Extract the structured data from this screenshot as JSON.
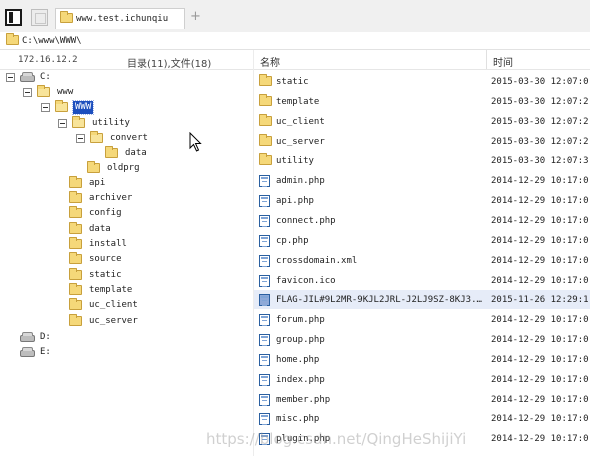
{
  "toolbar": {
    "sidebar_toggle_icon": "sidebar-icon",
    "new_window_icon": "window-icon"
  },
  "tab": {
    "title": "www.test.ichunqiu",
    "new_tab_label": "+"
  },
  "address": {
    "path": "C:\\www\\WWW\\"
  },
  "left": {
    "host": "172.16.12.2",
    "summary": "目录(11),文件(18)",
    "tree": [
      {
        "label": "C:",
        "kind": "drive",
        "expanded": true
      },
      {
        "label": "www",
        "kind": "folder",
        "expanded": true
      },
      {
        "label": "WWW",
        "kind": "folder",
        "expanded": true,
        "selected": true
      },
      {
        "label": "utility",
        "kind": "folder",
        "expanded": true
      },
      {
        "label": "convert",
        "kind": "folder",
        "expanded": true
      },
      {
        "label": "data",
        "kind": "folder"
      },
      {
        "label": "oldprg",
        "kind": "folder"
      },
      {
        "label": "api",
        "kind": "folder"
      },
      {
        "label": "archiver",
        "kind": "folder"
      },
      {
        "label": "config",
        "kind": "folder"
      },
      {
        "label": "data",
        "kind": "folder"
      },
      {
        "label": "install",
        "kind": "folder"
      },
      {
        "label": "source",
        "kind": "folder"
      },
      {
        "label": "static",
        "kind": "folder"
      },
      {
        "label": "template",
        "kind": "folder"
      },
      {
        "label": "uc_client",
        "kind": "folder"
      },
      {
        "label": "uc_server",
        "kind": "folder"
      },
      {
        "label": "D:",
        "kind": "drive"
      },
      {
        "label": "E:",
        "kind": "drive"
      }
    ]
  },
  "right": {
    "columns": {
      "name": "名称",
      "time": "时间"
    },
    "files": [
      {
        "name": "static",
        "time": "2015-03-30 12:07:0",
        "type": "folder"
      },
      {
        "name": "template",
        "time": "2015-03-30 12:07:2",
        "type": "folder"
      },
      {
        "name": "uc_client",
        "time": "2015-03-30 12:07:2",
        "type": "folder"
      },
      {
        "name": "uc_server",
        "time": "2015-03-30 12:07:2",
        "type": "folder"
      },
      {
        "name": "utility",
        "time": "2015-03-30 12:07:3",
        "type": "folder"
      },
      {
        "name": "admin.php",
        "time": "2014-12-29 10:17:0",
        "type": "file"
      },
      {
        "name": "api.php",
        "time": "2014-12-29 10:17:0",
        "type": "file"
      },
      {
        "name": "connect.php",
        "time": "2014-12-29 10:17:0",
        "type": "file"
      },
      {
        "name": "cp.php",
        "time": "2014-12-29 10:17:0",
        "type": "file"
      },
      {
        "name": "crossdomain.xml",
        "time": "2014-12-29 10:17:0",
        "type": "file"
      },
      {
        "name": "favicon.ico",
        "time": "2014-12-29 10:17:0",
        "type": "file"
      },
      {
        "name": "FLAG-JIL#9L2MR-9KJL2JRL-J2LJ9SZ-8KJ3...",
        "time": "2015-11-26 12:29:1",
        "type": "file",
        "selected": true
      },
      {
        "name": "forum.php",
        "time": "2014-12-29 10:17:0",
        "type": "file"
      },
      {
        "name": "group.php",
        "time": "2014-12-29 10:17:0",
        "type": "file"
      },
      {
        "name": "home.php",
        "time": "2014-12-29 10:17:0",
        "type": "file"
      },
      {
        "name": "index.php",
        "time": "2014-12-29 10:17:0",
        "type": "file"
      },
      {
        "name": "member.php",
        "time": "2014-12-29 10:17:0",
        "type": "file"
      },
      {
        "name": "misc.php",
        "time": "2014-12-29 10:17:0",
        "type": "file"
      },
      {
        "name": "plugin.php",
        "time": "2014-12-29 10:17:0",
        "type": "file"
      }
    ]
  },
  "watermark": "https://blog.csdn.net/QingHeShijiYi",
  "colors": {
    "selection": "#1d4fbe",
    "row_highlight": "#e6ecf8",
    "folder": "#f5d879"
  }
}
